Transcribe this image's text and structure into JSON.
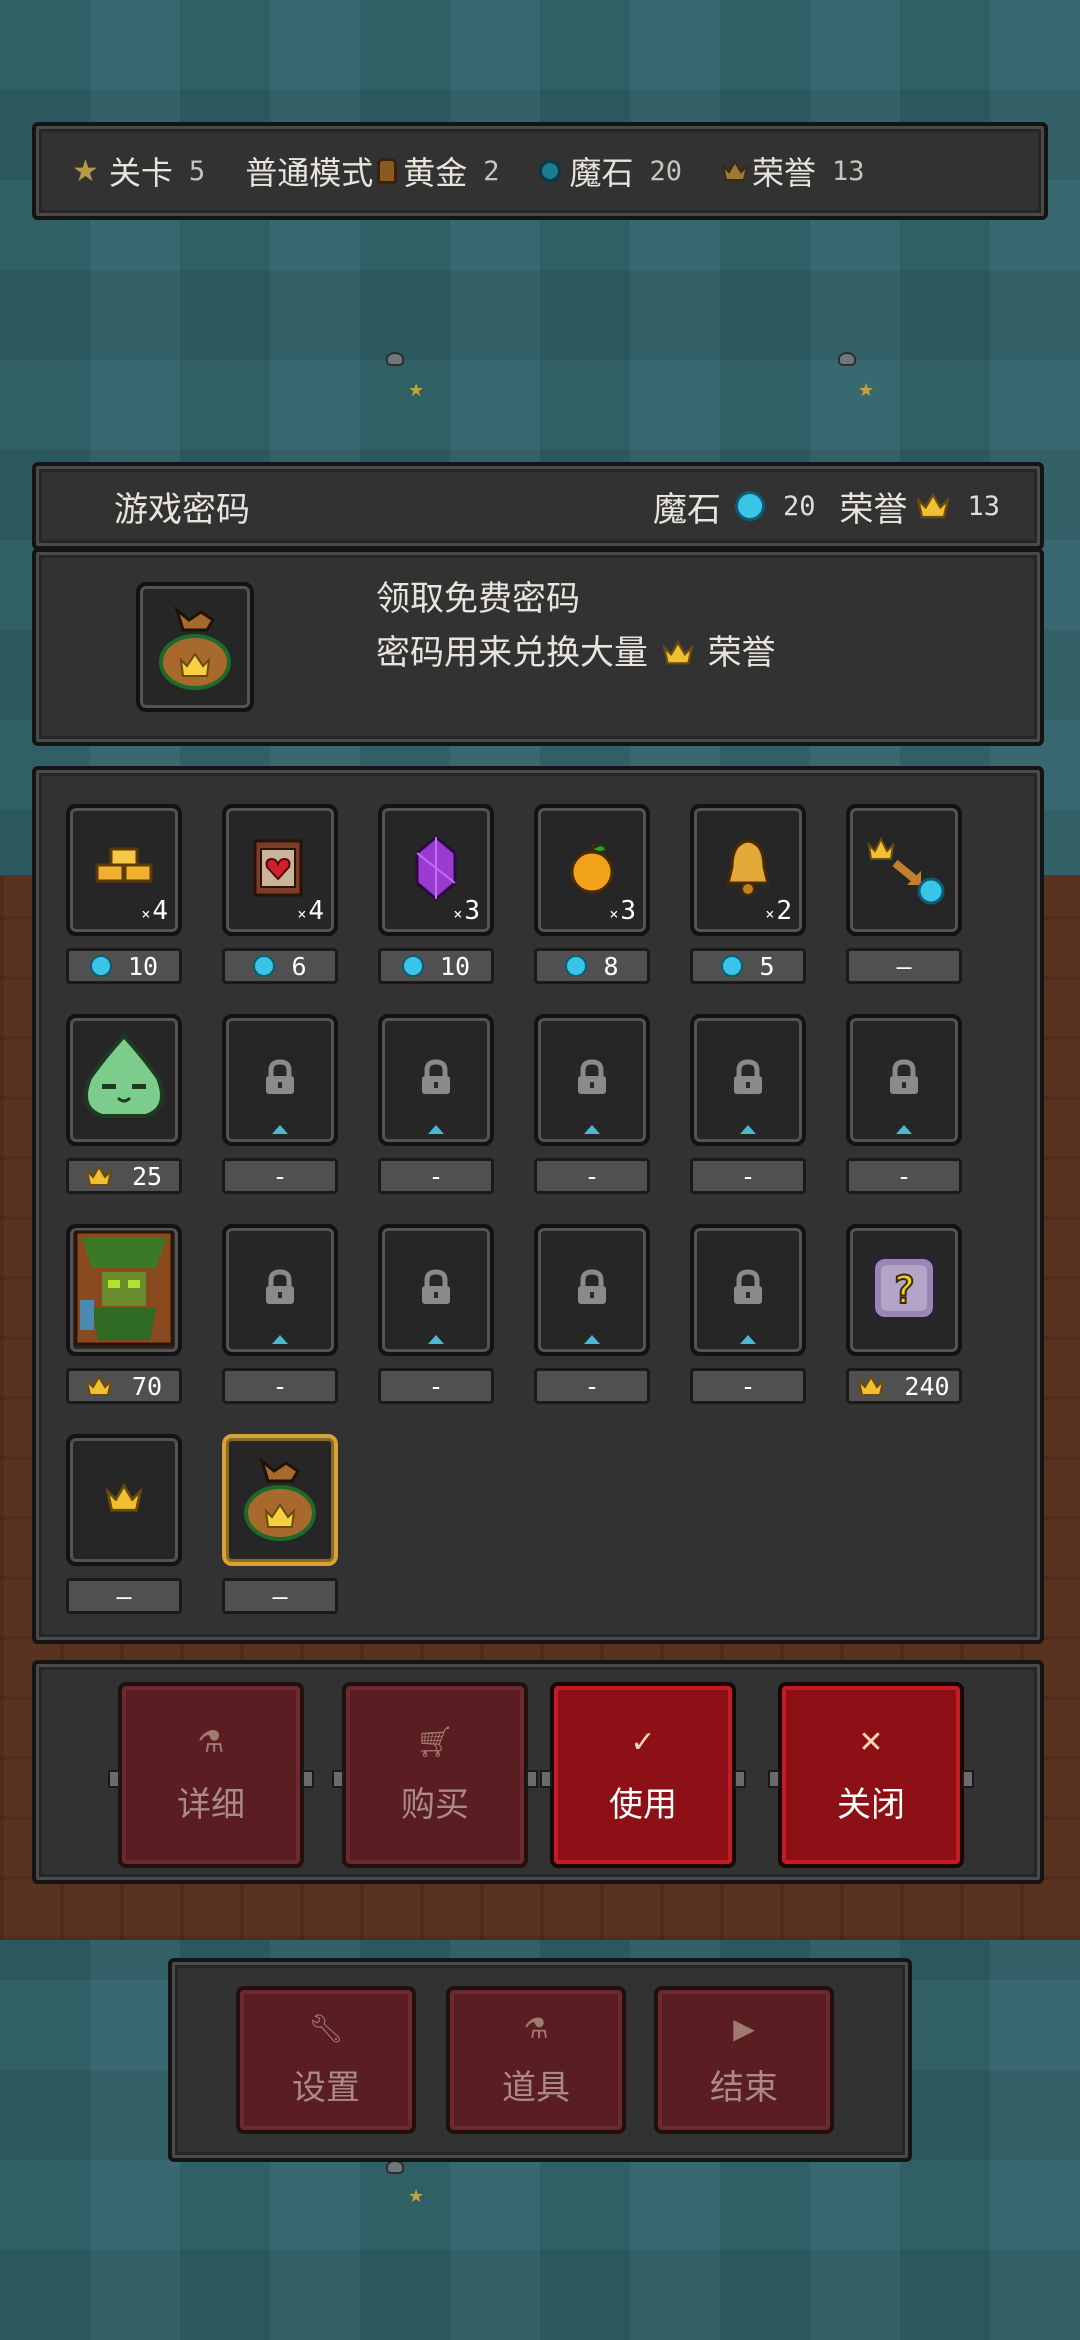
{
  "top_bar": {
    "level_label": "关卡",
    "level_value": "5",
    "mode": "普通模式",
    "gold_label": "黄金",
    "gold_value": "2",
    "magicstone_label": "魔石",
    "magicstone_value": "20",
    "honor_label": "荣誉",
    "honor_value": "13"
  },
  "header": {
    "title": "游戏密码",
    "magicstone_label": "魔石",
    "magicstone_value": "20",
    "honor_label": "荣誉",
    "honor_value": "13"
  },
  "info": {
    "line1": "领取免费密码",
    "line2_prefix": "密码用来兑换大量",
    "line2_suffix": "荣誉",
    "icon": "crown-sack-icon"
  },
  "items": [
    {
      "icon": "gold-bars-icon",
      "count": "4",
      "price": "10",
      "currency": "gem"
    },
    {
      "icon": "scroll-heart-icon",
      "count": "4",
      "price": "6",
      "currency": "gem"
    },
    {
      "icon": "purple-crystal-icon",
      "count": "3",
      "price": "10",
      "currency": "gem"
    },
    {
      "icon": "golden-apple-icon",
      "count": "3",
      "price": "8",
      "currency": "gem"
    },
    {
      "icon": "bell-icon",
      "count": "2",
      "price": "5",
      "currency": "gem"
    },
    {
      "icon": "crown-to-gem-icon",
      "count": "",
      "price": "—",
      "currency": "none"
    },
    {
      "icon": "slime-icon",
      "count": "",
      "price": "25",
      "currency": "crown"
    },
    {
      "icon": "lock-icon",
      "count": "",
      "price": "-",
      "currency": "none"
    },
    {
      "icon": "lock-icon",
      "count": "",
      "price": "-",
      "currency": "none"
    },
    {
      "icon": "lock-icon",
      "count": "",
      "price": "-",
      "currency": "none"
    },
    {
      "icon": "lock-icon",
      "count": "",
      "price": "-",
      "currency": "none"
    },
    {
      "icon": "lock-icon",
      "count": "",
      "price": "-",
      "currency": "none"
    },
    {
      "icon": "treant-icon",
      "count": "",
      "price": "70",
      "currency": "crown"
    },
    {
      "icon": "lock-icon",
      "count": "",
      "price": "-",
      "currency": "none"
    },
    {
      "icon": "lock-icon",
      "count": "",
      "price": "-",
      "currency": "none"
    },
    {
      "icon": "lock-icon",
      "count": "",
      "price": "-",
      "currency": "none"
    },
    {
      "icon": "lock-icon",
      "count": "",
      "price": "-",
      "currency": "none"
    },
    {
      "icon": "mystery-box-icon",
      "count": "",
      "price": "240",
      "currency": "crown"
    },
    {
      "icon": "crown-icon",
      "count": "",
      "price": "—",
      "currency": "none"
    },
    {
      "icon": "crown-sack-icon",
      "count": "",
      "price": "—",
      "currency": "none",
      "selected": true
    }
  ],
  "actions": {
    "detail": "详细",
    "buy": "购买",
    "use": "使用",
    "close": "关闭"
  },
  "bottom_menu": {
    "settings": "设置",
    "items": "道具",
    "end": "结束"
  },
  "colors": {
    "gem": "#38c5e8",
    "crown": "#f0c030",
    "active_button": "#8c1016",
    "selected_border": "#d7a236"
  }
}
